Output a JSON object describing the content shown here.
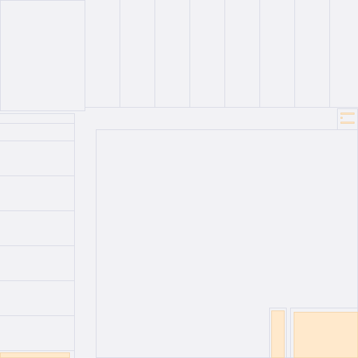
{
  "colors": {
    "background": "#f2f2f5",
    "grid_line": "#d9dbe6",
    "accent_fill": "#ffe9cc",
    "accent_text": "#f0c89a"
  },
  "visible_text": {
    "footer_snippet": "",
    "right_bottom_snippet": ""
  }
}
